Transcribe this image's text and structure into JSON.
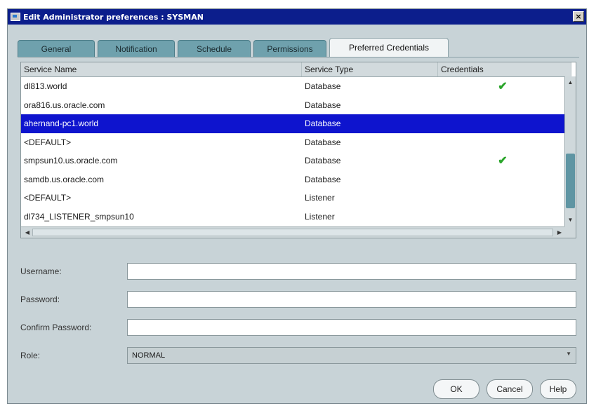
{
  "window": {
    "title": "Edit Administrator preferences : SYSMAN",
    "close_label": "×"
  },
  "tabs": [
    {
      "label": "General",
      "active": false
    },
    {
      "label": "Notification",
      "active": false
    },
    {
      "label": "Schedule",
      "active": false
    },
    {
      "label": "Permissions",
      "active": false
    },
    {
      "label": "Preferred Credentials",
      "active": true
    }
  ],
  "table": {
    "columns": [
      "Service Name",
      "Service Type",
      "Credentials"
    ],
    "rows": [
      {
        "name": "dl813.world",
        "type": "Database",
        "credentials": "✔",
        "selected": false
      },
      {
        "name": "ora816.us.oracle.com",
        "type": "Database",
        "credentials": "",
        "selected": false
      },
      {
        "name": "ahernand-pc1.world",
        "type": "Database",
        "credentials": "",
        "selected": true
      },
      {
        "name": "<DEFAULT>",
        "type": "Database",
        "credentials": "",
        "selected": false
      },
      {
        "name": "smpsun10.us.oracle.com",
        "type": "Database",
        "credentials": "✔",
        "selected": false
      },
      {
        "name": "samdb.us.oracle.com",
        "type": "Database",
        "credentials": "",
        "selected": false
      },
      {
        "name": "<DEFAULT>",
        "type": "Listener",
        "credentials": "",
        "selected": false
      },
      {
        "name": "dl734_LISTENER_smpsun10",
        "type": "Listener",
        "credentials": "",
        "selected": false
      }
    ]
  },
  "form": {
    "username_label": "Username:",
    "username_value": "",
    "password_label": "Password:",
    "password_value": "",
    "confirm_label": "Confirm Password:",
    "confirm_value": "",
    "role_label": "Role:",
    "role_value": "NORMAL"
  },
  "buttons": {
    "ok": "OK",
    "cancel": "Cancel",
    "help": "Help"
  },
  "colors": {
    "title_bar": "#0c1e8c",
    "selection": "#0e14ce",
    "check": "#2aa52a",
    "tab_inactive": "#6fa1ad",
    "panel": "#c8d3d7"
  }
}
